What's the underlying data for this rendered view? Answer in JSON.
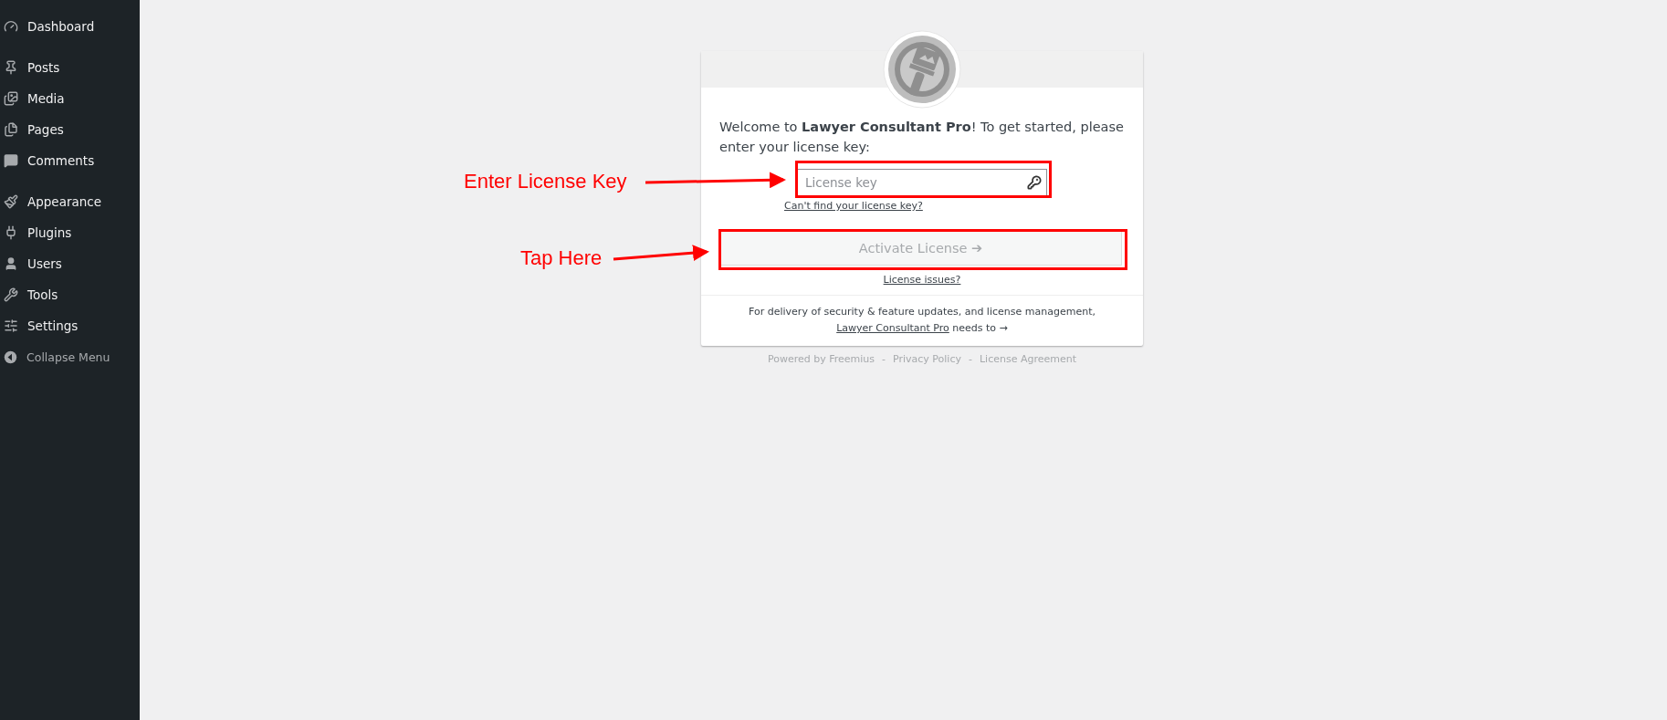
{
  "sidebar": {
    "items": [
      {
        "label": "Dashboard",
        "kind": "menu"
      },
      {
        "label": "Posts",
        "kind": "menu"
      },
      {
        "label": "Media",
        "kind": "menu"
      },
      {
        "label": "Pages",
        "kind": "menu"
      },
      {
        "label": "Comments",
        "kind": "menu"
      },
      {
        "label": "Appearance",
        "kind": "menu"
      },
      {
        "label": "Plugins",
        "kind": "menu"
      },
      {
        "label": "Users",
        "kind": "menu"
      },
      {
        "label": "Tools",
        "kind": "menu"
      },
      {
        "label": "Settings",
        "kind": "menu"
      },
      {
        "label": "Collapse Menu",
        "kind": "collapse"
      }
    ]
  },
  "card": {
    "welcome": "Welcome to **Lawyer Consultant Pro**! To get started, please enter your license key:",
    "license_field": {
      "placeholder": "License key"
    },
    "help_link": "Can't find your license key?",
    "activate_button": {
      "label": "Activate License ➔",
      "disabled": true
    },
    "issues_link": "License issues?",
    "notice": {
      "text": "For delivery of security & feature updates, and license management,",
      "link": "Lawyer Consultant Pro",
      "after": "needs to  →"
    }
  },
  "footer": {
    "links": [
      "Powered by Freemius",
      "Privacy Policy",
      "License Agreement"
    ],
    "separator": "-"
  },
  "annotations": [
    {
      "text": "Enter License Key"
    },
    {
      "text": "Tap Here"
    }
  ]
}
